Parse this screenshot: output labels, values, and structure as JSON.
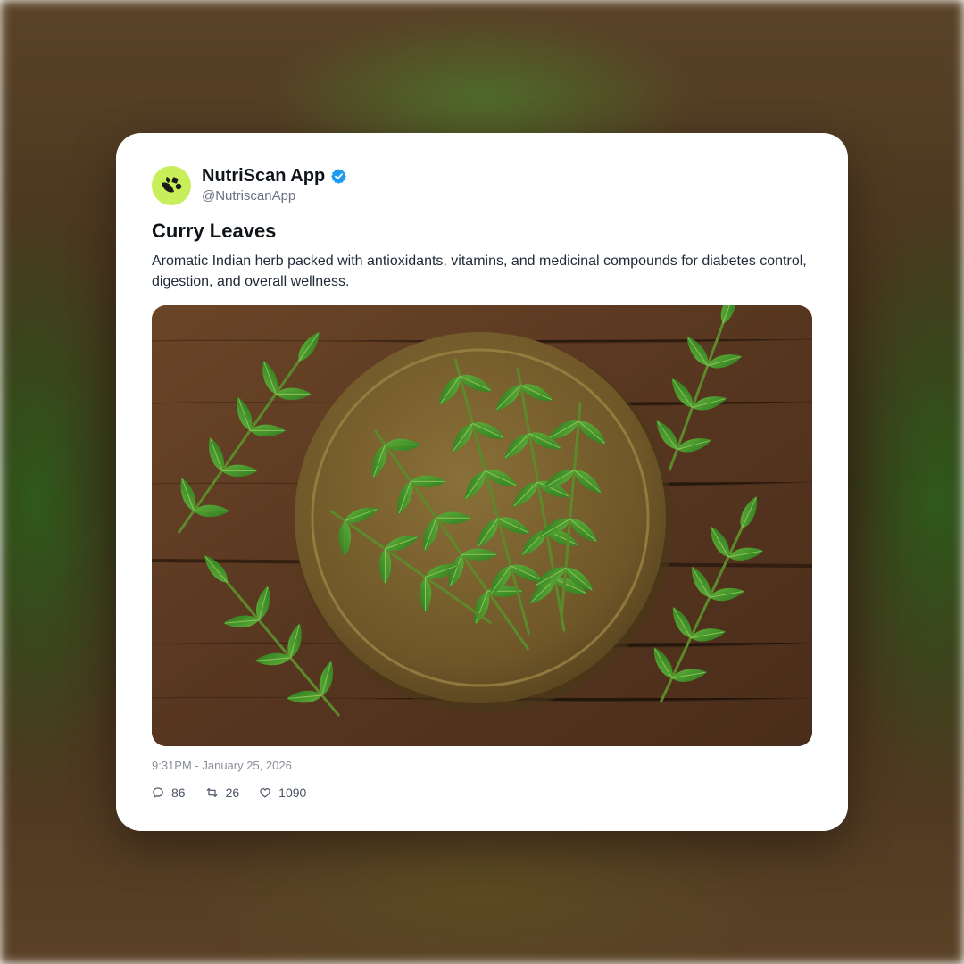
{
  "post": {
    "display_name": "NutriScan App",
    "handle": "@NutriscanApp",
    "verified": true,
    "title": "Curry Leaves",
    "description": "Aromatic Indian herb packed with antioxidants, vitamins, and medicinal compounds for diabetes control, digestion, and overall wellness.",
    "timestamp": "9:31PM - January 25, 2026",
    "image_alt": "Fresh curry leaf sprigs in a brass bowl on a dark wooden table"
  },
  "stats": {
    "replies": "86",
    "reposts": "26",
    "likes": "1090"
  },
  "icons": {
    "avatar": "leaf-logo-icon",
    "verified": "verified-badge-icon",
    "reply": "comment-icon",
    "repost": "repost-icon",
    "like": "heart-icon"
  },
  "colors": {
    "avatar_bg": "#c8ee5a",
    "verified_blue": "#1d9bf0",
    "card_bg": "#ffffff"
  }
}
